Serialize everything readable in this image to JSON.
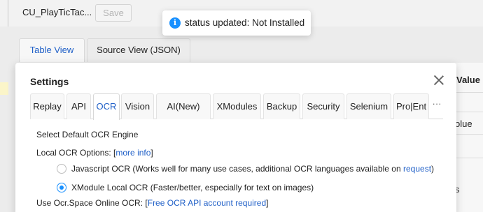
{
  "app": {
    "macro_name": "CU_PlayTicTac...",
    "save_label": "Save"
  },
  "main_tabs": [
    {
      "label": "Table View",
      "active": true
    },
    {
      "label": "Source View (JSON)",
      "active": false
    }
  ],
  "table": {
    "value_header": "Value",
    "cells": [
      "olue",
      "s"
    ]
  },
  "toast": {
    "icon": "info-icon",
    "icon_glyph": "i",
    "text": "status updated: Not Installed"
  },
  "modal": {
    "title": "Settings",
    "close_icon": "close-icon",
    "tabs": [
      {
        "label": "Replay"
      },
      {
        "label": "API"
      },
      {
        "label": "OCR",
        "active": true
      },
      {
        "label": "Vision"
      },
      {
        "label": "AI(New)"
      },
      {
        "label": "XModules"
      },
      {
        "label": "Backup"
      },
      {
        "label": "Security"
      },
      {
        "label": "Selenium"
      },
      {
        "label": "Pro|Ent"
      },
      {
        "label": "···"
      }
    ],
    "ocr": {
      "select_engine_label": "Select Default OCR Engine",
      "local_options_label": "Local OCR Options: [",
      "local_more_info_link": "more info",
      "local_options_close": "]",
      "options": [
        {
          "label": "Javascript OCR (Works well for many use cases, additional OCR languages available on ",
          "link": "request",
          "suffix": ")",
          "selected": false
        },
        {
          "label": "XModule Local OCR (Faster/better, especially for text on images)",
          "selected": true
        }
      ],
      "online_label": "Use Ocr.Space Online OCR: [",
      "online_link": "Free OCR API account required",
      "online_close": "]"
    }
  },
  "colors": {
    "accent": "#1f5fc7",
    "radio_active": "#1890ff",
    "toast_icon": "#1890ff"
  }
}
